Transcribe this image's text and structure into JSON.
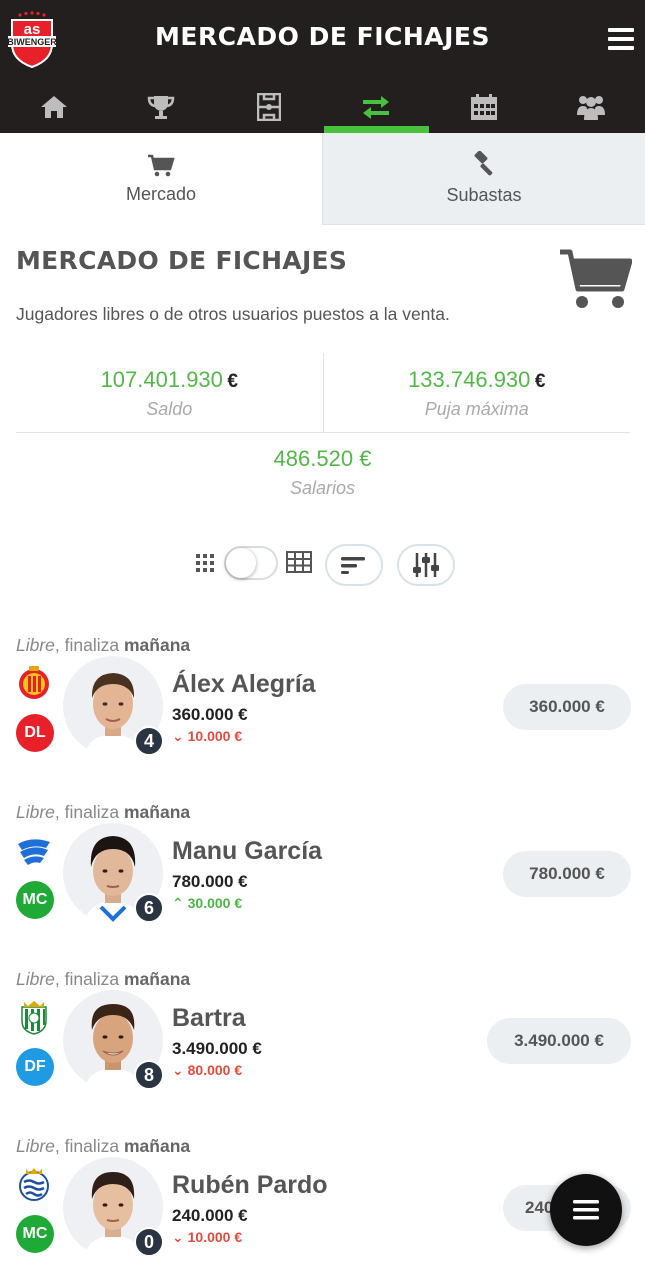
{
  "header": {
    "logo_text_top": "as",
    "logo_text_bottom": "BIWENGER",
    "title": "MERCADO DE FICHAJES",
    "nav": [
      {
        "icon": "home-icon",
        "active": false
      },
      {
        "icon": "trophy-icon",
        "active": false
      },
      {
        "icon": "lineup-icon",
        "active": false
      },
      {
        "icon": "transfer-icon",
        "active": true
      },
      {
        "icon": "calendar-icon",
        "active": false
      },
      {
        "icon": "users-icon",
        "active": false
      }
    ]
  },
  "tabs": [
    {
      "label": "Mercado",
      "icon": "cart-icon",
      "active": true
    },
    {
      "label": "Subastas",
      "icon": "gavel-icon",
      "active": false
    }
  ],
  "section": {
    "title": "MERCADO DE FICHAJES",
    "description": "Jugadores libres o de otros usuarios puestos a la venta."
  },
  "stats": {
    "saldo": {
      "value": "107.401.930",
      "currency": "€",
      "label": "Saldo"
    },
    "puja": {
      "value": "133.746.930",
      "currency": "€",
      "label": "Puja máxima"
    },
    "salarios": {
      "value": "486.520 €",
      "label": "Salarios"
    }
  },
  "players": [
    {
      "status_italic": "Libre",
      "status_text": ", finaliza ",
      "status_bold": "mañana",
      "name": "Álex Alegría",
      "value": "360.000 €",
      "delta": "10.000 €",
      "trend": "down",
      "position": "DL",
      "position_color": "#e8202a",
      "points": "4",
      "bid": "360.000 €",
      "team": "mallorca"
    },
    {
      "status_italic": "Libre",
      "status_text": ", finaliza ",
      "status_bold": "mañana",
      "name": "Manu García",
      "value": "780.000 €",
      "delta": "30.000 €",
      "trend": "up",
      "position": "MC",
      "position_color": "#1fa936",
      "points": "6",
      "bid": "780.000 €",
      "team": "alaves"
    },
    {
      "status_italic": "Libre",
      "status_text": ", finaliza ",
      "status_bold": "mañana",
      "name": "Bartra",
      "value": "3.490.000 €",
      "delta": "80.000 €",
      "trend": "down",
      "position": "DF",
      "position_color": "#1e9be3",
      "points": "8",
      "bid": "3.490.000 €",
      "team": "betis"
    },
    {
      "status_italic": "Libre",
      "status_text": ", finaliza ",
      "status_bold": "mañana",
      "name": "Rubén Pardo",
      "value": "240.000 €",
      "delta": "10.000 €",
      "trend": "down",
      "position": "MC",
      "position_color": "#1fa936",
      "points": "0",
      "bid": "240",
      "team": "realsociedad"
    }
  ],
  "colors": {
    "accent": "#48c23d",
    "money": "#52b848",
    "header_bg": "#231f1f"
  }
}
